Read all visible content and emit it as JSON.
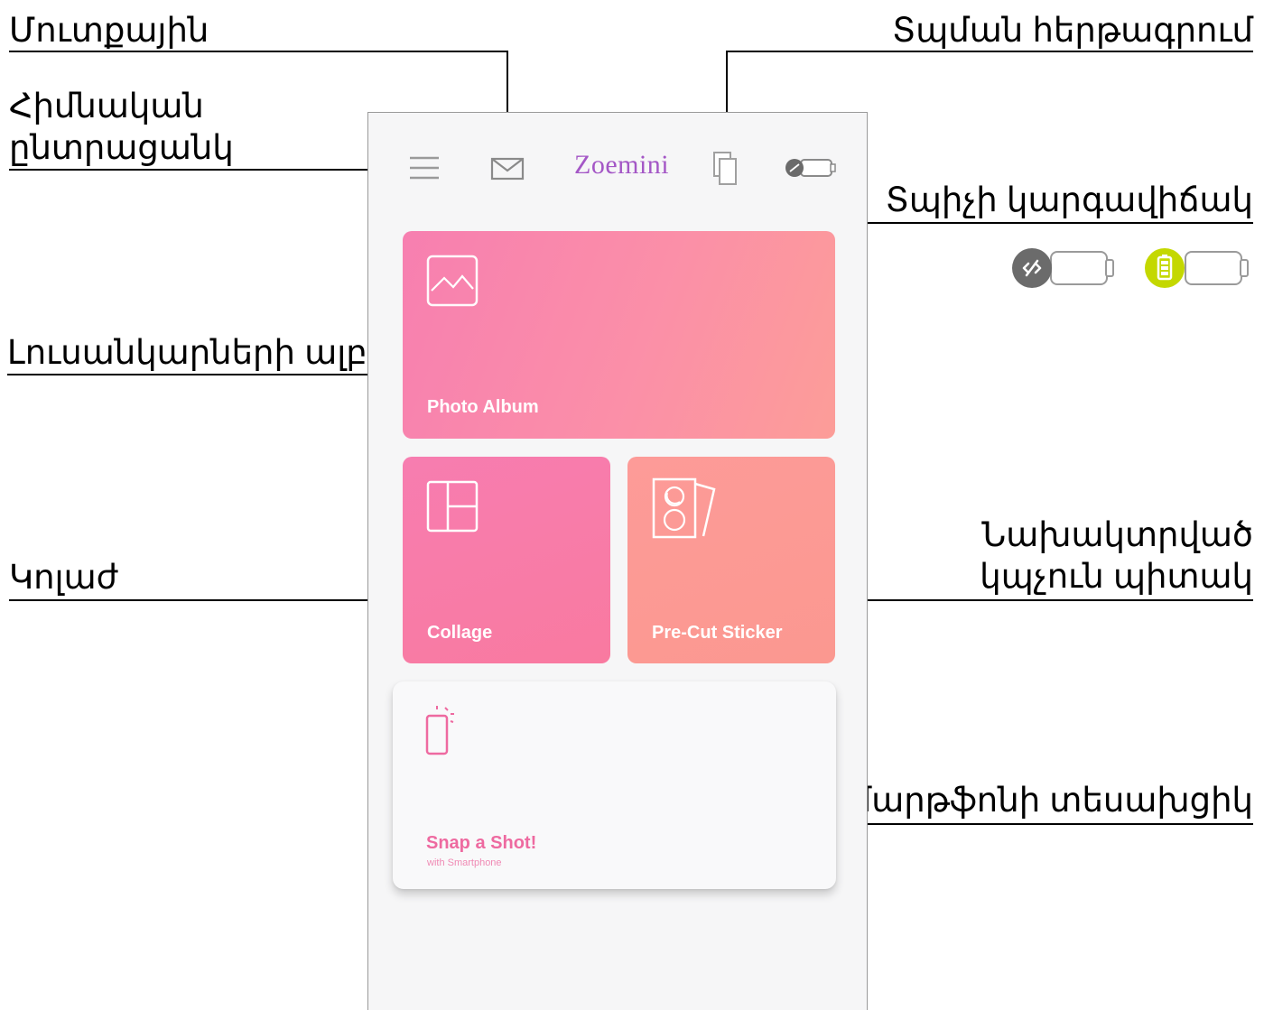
{
  "callouts": {
    "inbox": "Մուտքային",
    "main_menu_line1": "Հիմնական",
    "main_menu_line2": "ընտրացանկ",
    "print_queue": "Տպման հերթագրում",
    "printer_status": "Տպիչի կարգավիճակ",
    "photo_album": "Լուսանկարների ալբոմ",
    "collage": "Կոլաժ",
    "precut_line1": "Նախակտրված",
    "precut_line2": "կպչուն պիտակ",
    "smartphone_viewfinder": "Սմարթֆոնի տեսախցիկ"
  },
  "app": {
    "brand": "Zoemini",
    "cards": {
      "photo_album": "Photo Album",
      "collage": "Collage",
      "precut_sticker": "Pre-Cut Sticker",
      "snap_title": "Snap a Shot!",
      "snap_subtitle": "with Smartphone"
    }
  },
  "status_icons": [
    {
      "name": "disconnected-printer-icon",
      "color": "#6b6b6b"
    },
    {
      "name": "battery-connected-printer-icon",
      "color": "#c4d800"
    }
  ],
  "colors": {
    "brand": "#a457c6",
    "card_pink": "#f77fb0",
    "card_coral": "#fc9d98",
    "snap_pink": "#ee6aa0"
  }
}
